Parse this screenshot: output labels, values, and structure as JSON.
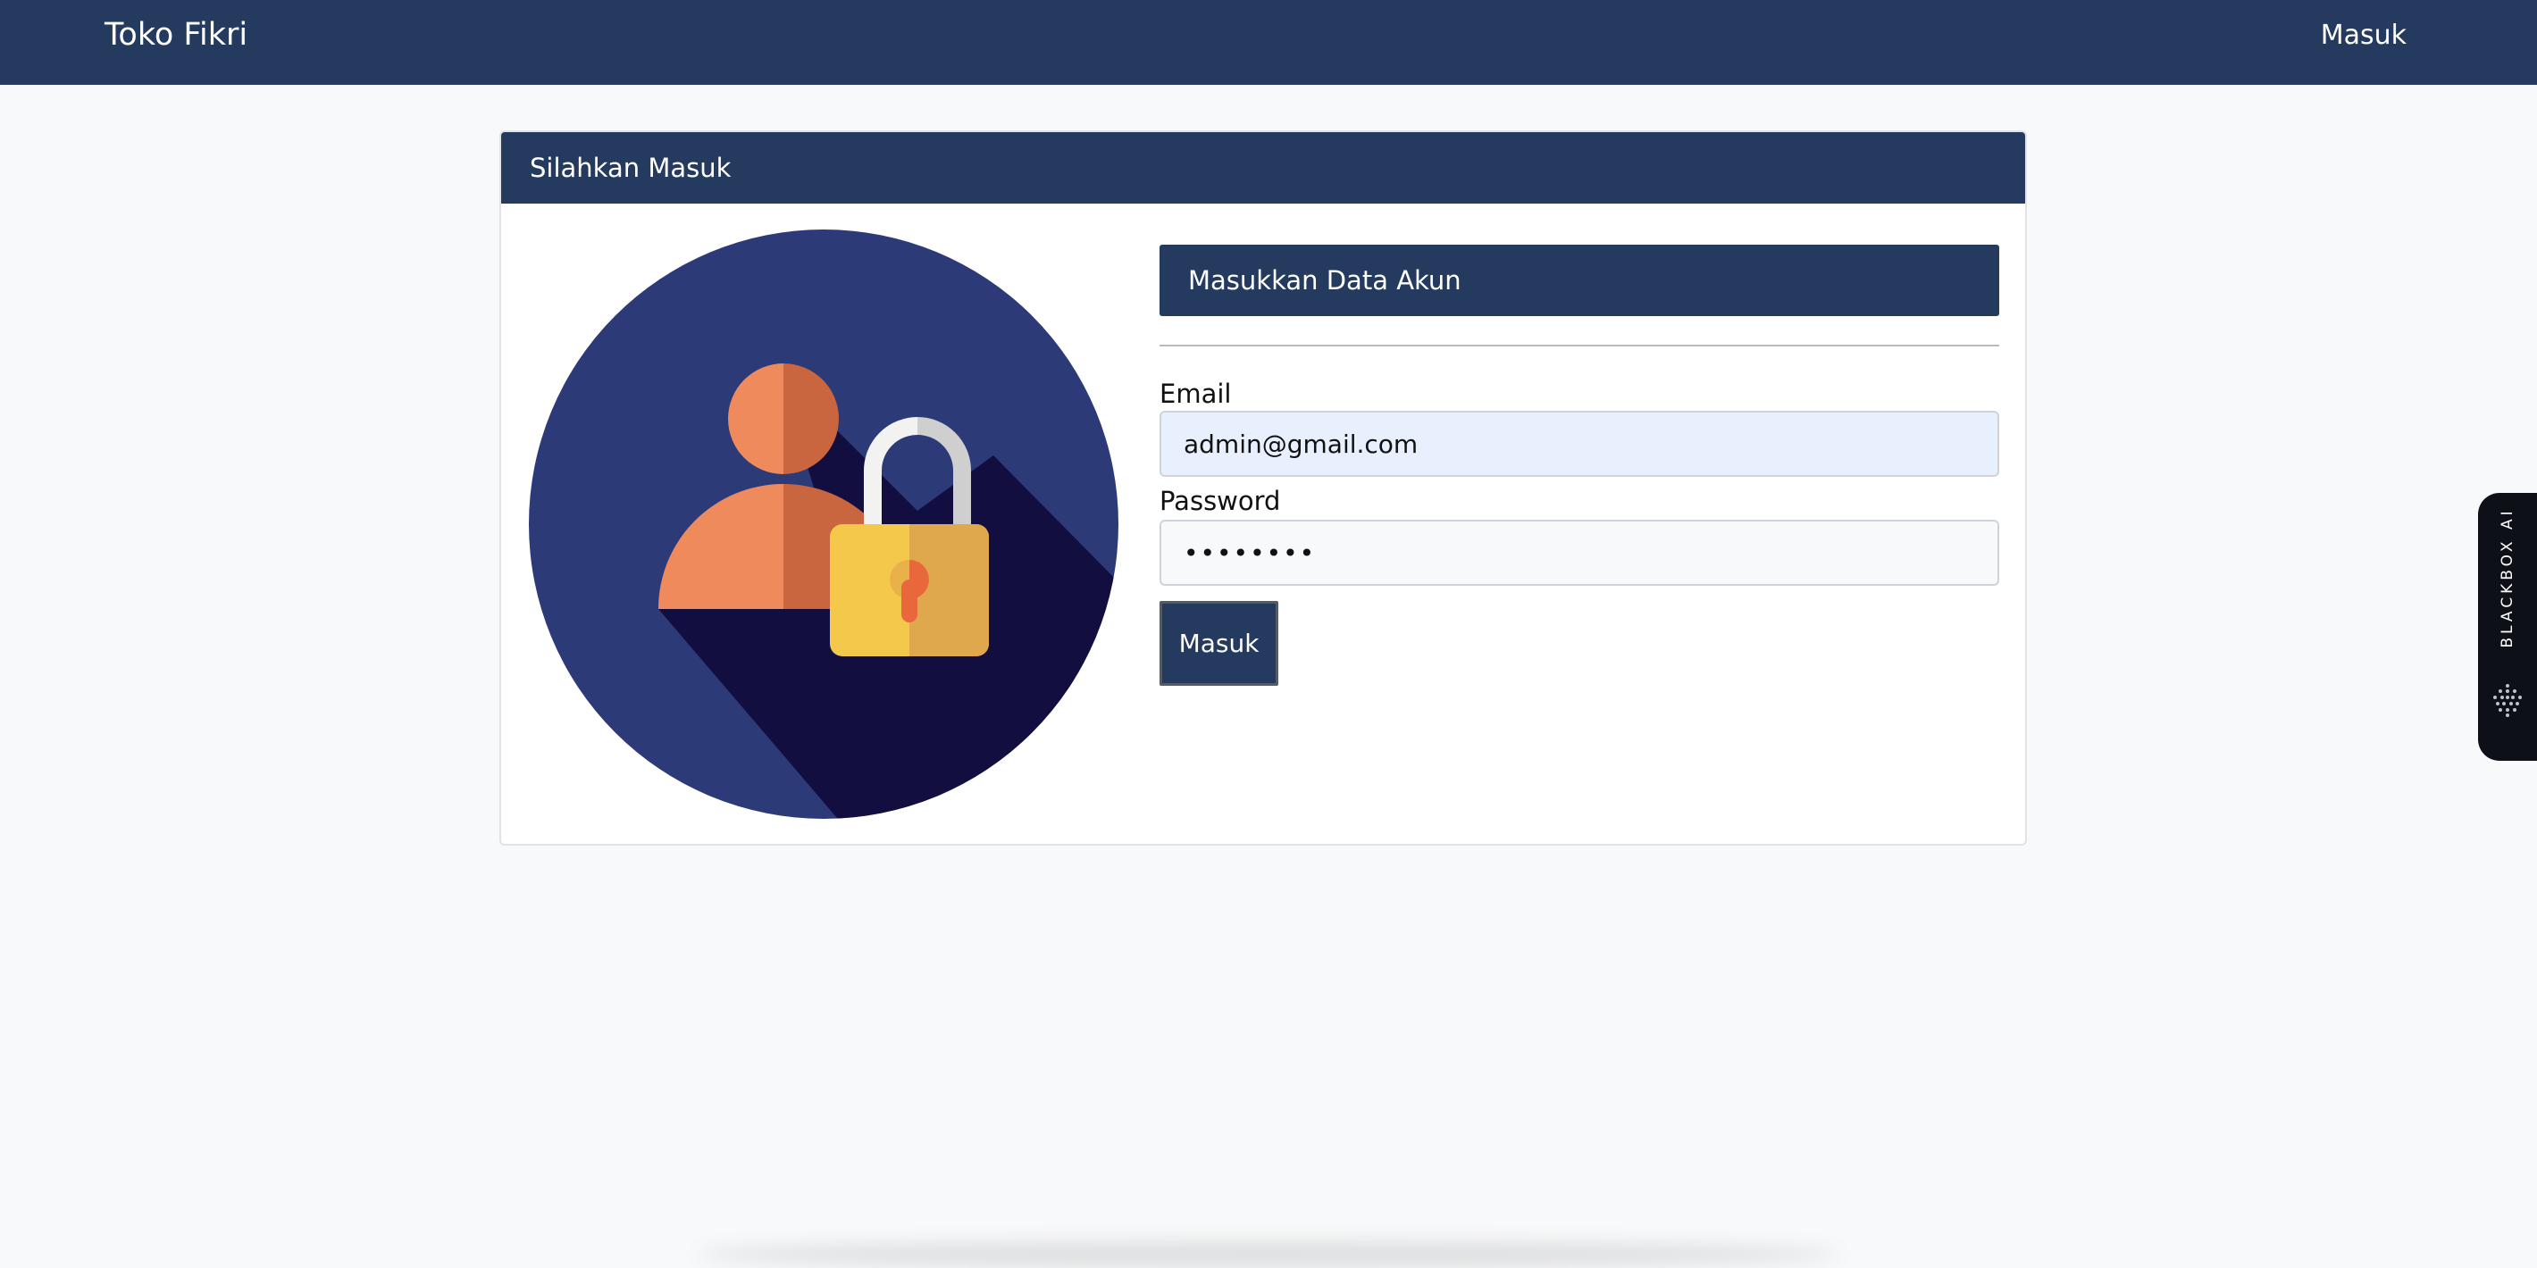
{
  "navbar": {
    "brand": "Toko Fikri",
    "login_link": "Masuk"
  },
  "card": {
    "header": "Silahkan Masuk"
  },
  "illustration": {
    "icon": "user-lock-icon"
  },
  "form": {
    "title": "Masukkan Data Akun",
    "email_label": "Email",
    "email_value": "admin@gmail.com",
    "password_label": "Password",
    "password_value": "••••••••",
    "submit_label": "Masuk"
  },
  "side_widget": {
    "label": "BLACKBOX AI"
  },
  "colors": {
    "primary": "#243a5e",
    "page_background": "#f8f9fa",
    "circle": "#2d3a78",
    "person": "#ef8a5c",
    "lock": "#f4c84a"
  }
}
